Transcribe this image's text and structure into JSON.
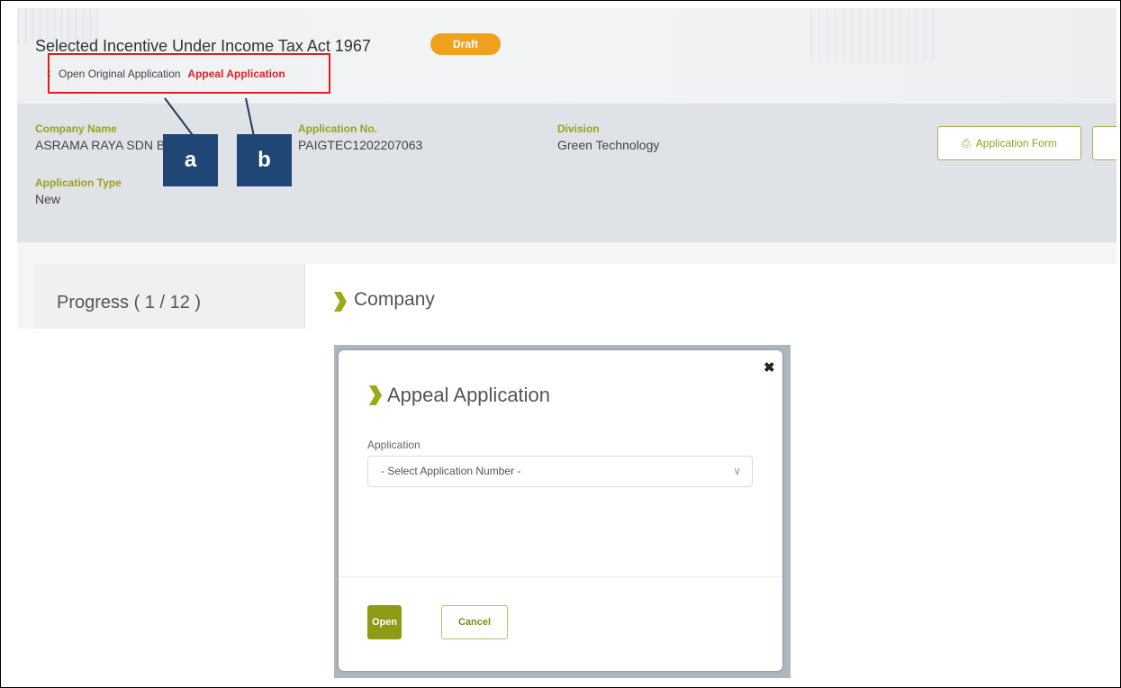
{
  "header": {
    "title": "Selected Incentive Under Income Tax Act 1967",
    "status_badge": "Draft",
    "back_icon": "chevron-left-icon",
    "open_original_link": "Open Original Application",
    "appeal_link": "Appeal Application"
  },
  "info": {
    "company_name_label": "Company Name",
    "company_name_value": "ASRAMA RAYA SDN B",
    "application_no_label": "Application No.",
    "application_no_value": "PAIGTEC1202207063",
    "division_label": "Division",
    "division_value": "Green Technology",
    "application_type_label": "Application Type",
    "application_type_value": "New",
    "application_form_button": "Application Form",
    "print_icon": "printer-icon"
  },
  "progress": {
    "label": "Progress ( 1 / 12 )"
  },
  "section": {
    "title": "Company"
  },
  "annotations": {
    "a": "a",
    "b": "b"
  },
  "modal": {
    "title": "Appeal Application",
    "close_icon": "close-icon",
    "field_label": "Application",
    "select_placeholder": "- Select Application Number -",
    "open_button": "Open",
    "cancel_button": "Cancel"
  },
  "colors": {
    "accent": "#9aaa18",
    "badge": "#f0a11c",
    "callout": "#e02020",
    "tag": "#1f4675"
  }
}
